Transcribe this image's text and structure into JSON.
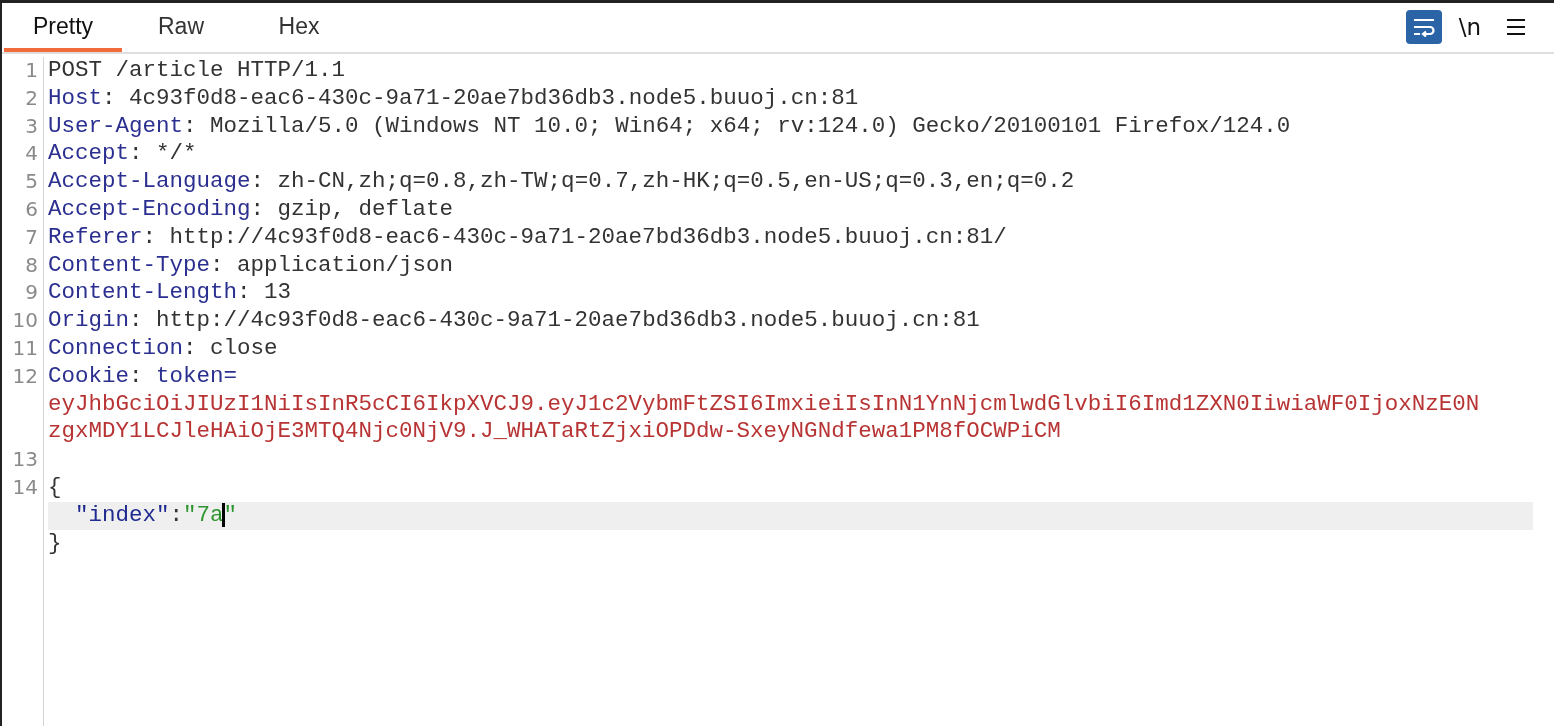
{
  "tabs": [
    {
      "label": "Pretty",
      "selected": true
    },
    {
      "label": "Raw",
      "selected": false
    },
    {
      "label": "Hex",
      "selected": false
    }
  ],
  "toolbar": {
    "wrap_on": true,
    "newline_label": "\\n"
  },
  "lines": [
    {
      "number": "1",
      "kind": "request_line",
      "text": "POST /article HTTP/1.1"
    },
    {
      "number": "2",
      "kind": "header",
      "name": "Host",
      "sep": ":",
      "value": "4c93f0d8-eac6-430c-9a71-20ae7bd36db3.node5.buuoj.cn:81"
    },
    {
      "number": "3",
      "kind": "header",
      "name": "User-Agent",
      "sep": ":",
      "value": "Mozilla/5.0 (Windows NT 10.0; Win64; x64; rv:124.0) Gecko/20100101 Firefox/124.0"
    },
    {
      "number": "4",
      "kind": "header",
      "name": "Accept",
      "sep": ":",
      "value": "*/*"
    },
    {
      "number": "5",
      "kind": "header",
      "name": "Accept-Language",
      "sep": ":",
      "value": "zh-CN,zh;q=0.8,zh-TW;q=0.7,zh-HK;q=0.5,en-US;q=0.3,en;q=0.2"
    },
    {
      "number": "6",
      "kind": "header",
      "name": "Accept-Encoding",
      "sep": ":",
      "value": "gzip, deflate"
    },
    {
      "number": "7",
      "kind": "header",
      "name": "Referer",
      "sep": ":",
      "value": "http://4c93f0d8-eac6-430c-9a71-20ae7bd36db3.node5.buuoj.cn:81/"
    },
    {
      "number": "8",
      "kind": "header",
      "name": "Content-Type",
      "sep": ":",
      "value": "application/json"
    },
    {
      "number": "9",
      "kind": "header",
      "name": "Content-Length",
      "sep": ":",
      "value": "13"
    },
    {
      "number": "10",
      "kind": "header",
      "name": "Origin",
      "sep": ":",
      "value": "http://4c93f0d8-eac6-430c-9a71-20ae7bd36db3.node5.buuoj.cn:81"
    },
    {
      "number": "11",
      "kind": "header",
      "name": "Connection",
      "sep": ":",
      "value": "close"
    },
    {
      "number": "12",
      "kind": "cookie",
      "name": "Cookie",
      "sep": ":",
      "cookie_name": "token=",
      "value_lines": [
        "eyJhbGciOiJIUzI1NiIsInR5cCI6IkpXVCJ9.eyJ1c2VybmFtZSI6ImxieiIsInN1YnNjcmlwdGlvbiI6Imd1ZXN0IiwiaWF0IjoxNzE0N",
        "zgxMDY1LCJleHAiOjE3MTQ4Njc0NjV9.J_WHATaRtZjxiOPDdw-SxeyNGNdfewa1PM8fOCWPiCM"
      ]
    },
    {
      "number": "13",
      "kind": "blank"
    },
    {
      "number": "14",
      "kind": "json",
      "open": "{",
      "key": "\"index\"",
      "colon": ":",
      "value_before_cursor": "\"7a",
      "value_after_cursor": "\"",
      "close": "}",
      "current": true
    }
  ]
}
